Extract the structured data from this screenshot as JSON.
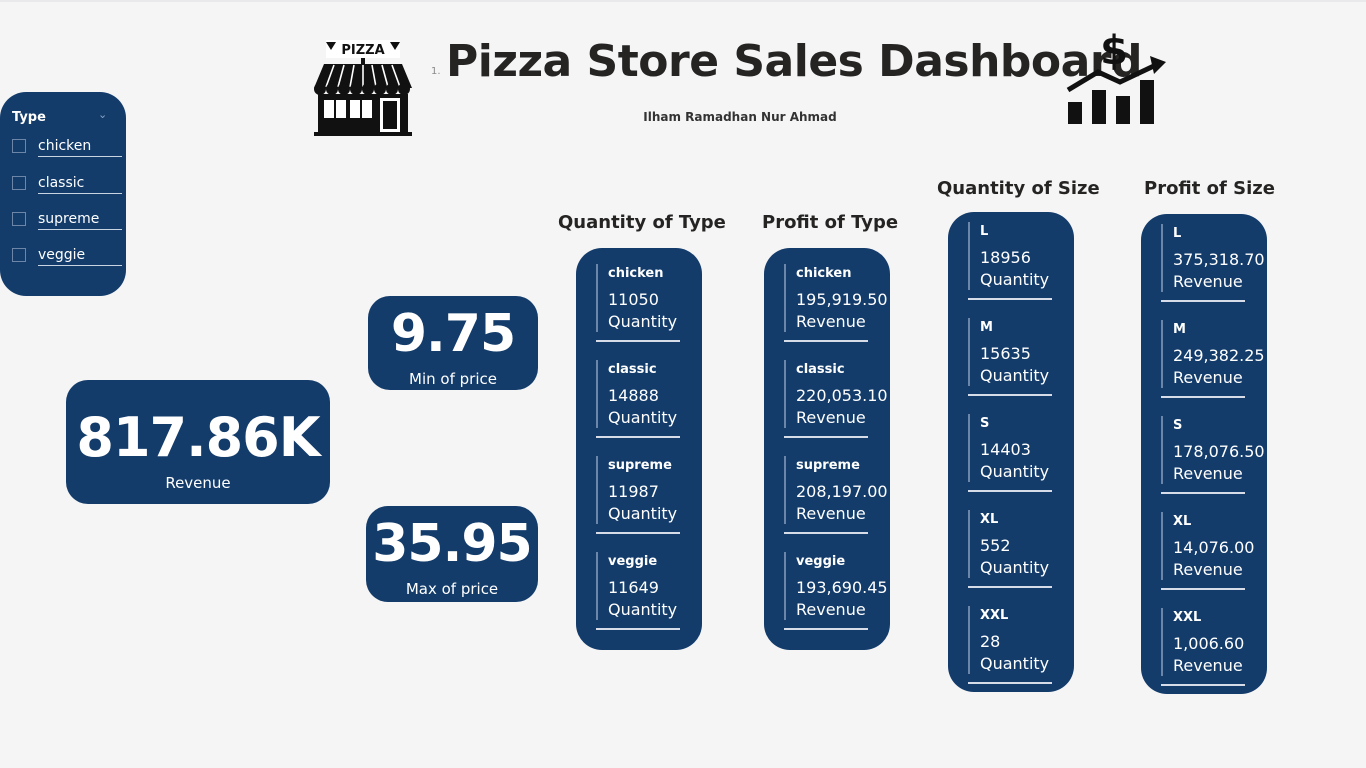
{
  "header": {
    "title_number": "1.",
    "title": "Pizza Store Sales Dashboard",
    "author": "Ilham Ramadhan Nur Ahmad",
    "store_sign": "PIZZA",
    "dollar_symbol": "$"
  },
  "slicer": {
    "title": "Type",
    "chevron": "⌄",
    "items": [
      "chicken",
      "classic",
      "supreme",
      "veggie"
    ]
  },
  "cards": {
    "revenue": {
      "value": "817.86K",
      "label": "Revenue"
    },
    "min_price": {
      "value": "9.75",
      "label": "Min of price"
    },
    "max_price": {
      "value": "35.95",
      "label": "Max of price"
    }
  },
  "quantity_of_type": {
    "title": "Quantity of Type",
    "rows": [
      {
        "name": "chicken",
        "value": "11050",
        "label": "Quantity"
      },
      {
        "name": "classic",
        "value": "14888",
        "label": "Quantity"
      },
      {
        "name": "supreme",
        "value": "11987",
        "label": "Quantity"
      },
      {
        "name": "veggie",
        "value": "11649",
        "label": "Quantity"
      }
    ]
  },
  "profit_of_type": {
    "title": "Profit of Type",
    "rows": [
      {
        "name": "chicken",
        "value": "195,919.50",
        "label": "Revenue"
      },
      {
        "name": "classic",
        "value": "220,053.10",
        "label": "Revenue"
      },
      {
        "name": "supreme",
        "value": "208,197.00",
        "label": "Revenue"
      },
      {
        "name": "veggie",
        "value": "193,690.45",
        "label": "Revenue"
      }
    ]
  },
  "quantity_of_size": {
    "title": "Quantity of Size",
    "rows": [
      {
        "name": "L",
        "value": "18956",
        "label": "Quantity"
      },
      {
        "name": "M",
        "value": "15635",
        "label": "Quantity"
      },
      {
        "name": "S",
        "value": "14403",
        "label": "Quantity"
      },
      {
        "name": "XL",
        "value": "552",
        "label": "Quantity"
      },
      {
        "name": "XXL",
        "value": "28",
        "label": "Quantity"
      }
    ]
  },
  "profit_of_size": {
    "title": "Profit of Size",
    "rows": [
      {
        "name": "L",
        "value": "375,318.70",
        "label": "Revenue"
      },
      {
        "name": "M",
        "value": "249,382.25",
        "label": "Revenue"
      },
      {
        "name": "S",
        "value": "178,076.50",
        "label": "Revenue"
      },
      {
        "name": "XL",
        "value": "14,076.00",
        "label": "Revenue"
      },
      {
        "name": "XXL",
        "value": "1,006.60",
        "label": "Revenue"
      }
    ]
  },
  "colors": {
    "card_bg": "#133c6b",
    "card_text": "#ffffff",
    "page_bg": "#f5f5f6",
    "title_text": "#252423"
  },
  "icons": [
    "pizza-store-icon",
    "revenue-growth-chart-icon",
    "chevron-down-icon",
    "checkbox-icon"
  ]
}
